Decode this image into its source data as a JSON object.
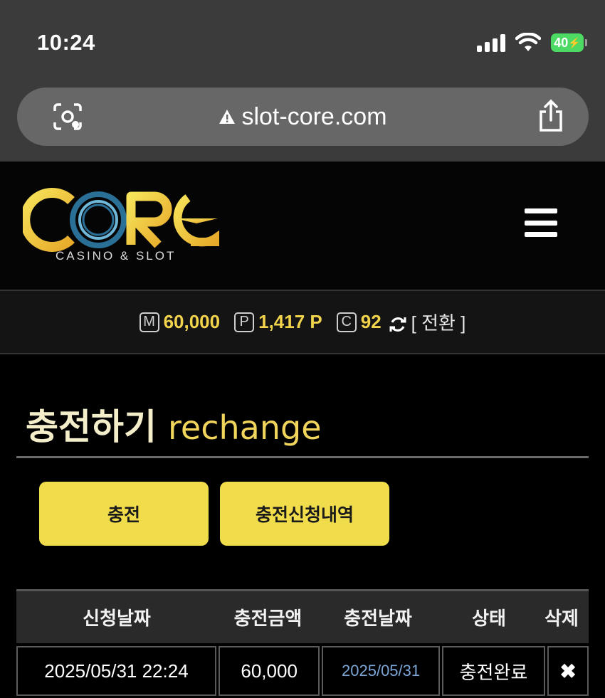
{
  "status_bar": {
    "time": "10:24",
    "battery": "40"
  },
  "browser": {
    "url": "slot-core.com"
  },
  "logo": {
    "brand": "CORE",
    "tagline": "CASINO & SLOT"
  },
  "balance": {
    "money_badge": "M",
    "money": "60,000",
    "point_badge": "P",
    "point": "1,417 P",
    "coin_badge": "C",
    "coin": "92",
    "switch_label": "[ 전환 ]"
  },
  "page": {
    "title_ko": "충전하기",
    "title_en": "rechange"
  },
  "buttons": {
    "charge": "충전",
    "history": "충전신청내역"
  },
  "table": {
    "headers": [
      "신청날짜",
      "충전금액",
      "충전날짜",
      "상태",
      "삭제"
    ],
    "rows": [
      {
        "request_date": "2025/05/31 22:24",
        "amount": "60,000",
        "charge_date": "2025/05/31",
        "status": "충전완료",
        "delete": "✖"
      }
    ]
  },
  "colors": {
    "accent": "#f1dd4c",
    "value_gold": "#f2d34c",
    "link_blue": "#7da6d8"
  }
}
